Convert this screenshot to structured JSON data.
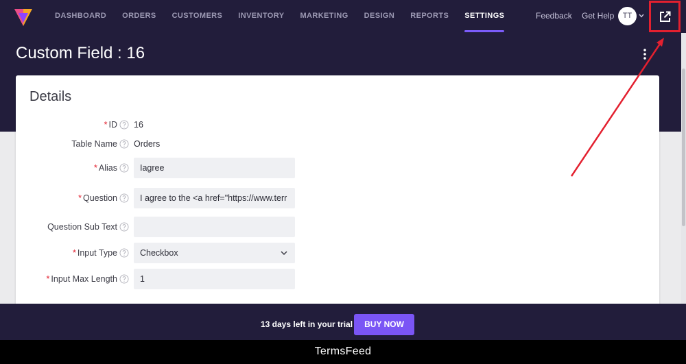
{
  "nav": {
    "items": [
      {
        "label": "DASHBOARD",
        "active": false
      },
      {
        "label": "ORDERS",
        "active": false
      },
      {
        "label": "CUSTOMERS",
        "active": false
      },
      {
        "label": "INVENTORY",
        "active": false
      },
      {
        "label": "MARKETING",
        "active": false
      },
      {
        "label": "DESIGN",
        "active": false
      },
      {
        "label": "REPORTS",
        "active": false
      },
      {
        "label": "SETTINGS",
        "active": true
      }
    ],
    "feedback": "Feedback",
    "help": "Get Help",
    "avatar_initials": "TT"
  },
  "page": {
    "title": "Custom Field : 16"
  },
  "details": {
    "heading": "Details",
    "rows": [
      {
        "label": "ID",
        "required": true,
        "type": "text",
        "value": "16"
      },
      {
        "label": "Table Name",
        "required": false,
        "type": "text",
        "value": "Orders"
      },
      {
        "label": "Alias",
        "required": true,
        "type": "input",
        "value": "Iagree"
      },
      {
        "label": "Question",
        "required": true,
        "type": "input",
        "value": "I agree to the <a href=\"https://www.terr"
      },
      {
        "label": "Question Sub Text",
        "required": false,
        "type": "input",
        "value": ""
      },
      {
        "label": "Input Type",
        "required": true,
        "type": "select",
        "value": "Checkbox"
      },
      {
        "label": "Input Max Length",
        "required": true,
        "type": "input",
        "value": "1"
      }
    ]
  },
  "trial": {
    "text": "13 days left in your trial",
    "button": "BUY NOW"
  },
  "footer": {
    "text": "TermsFeed"
  },
  "colors": {
    "header_bg": "#221d3b",
    "accent": "#7c5cfa",
    "highlight": "#e3202f"
  }
}
